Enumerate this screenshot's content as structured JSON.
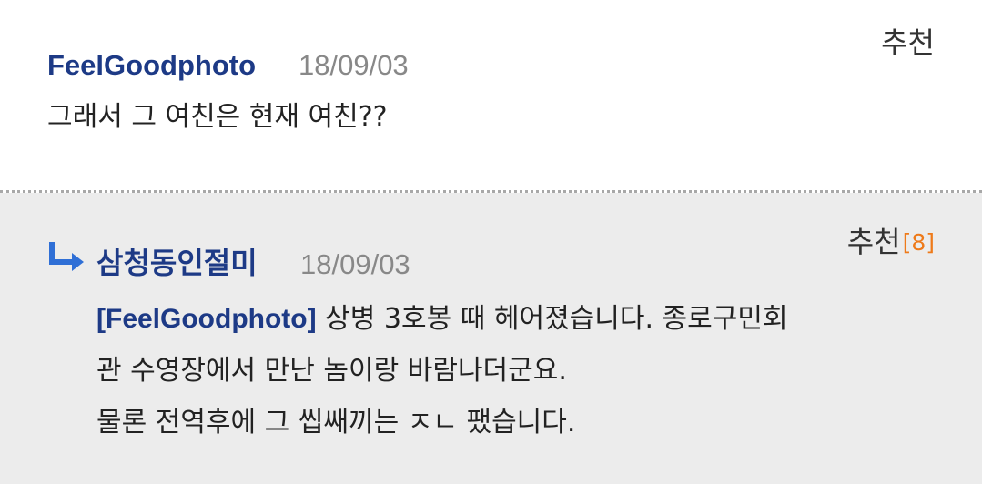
{
  "comments": [
    {
      "author": "FeelGoodphoto",
      "date": "18/09/03",
      "recommend_label": "추천",
      "text": "그래서 그 여친은 현재 여친??"
    },
    {
      "author": "삼청동인절미",
      "date": "18/09/03",
      "recommend_label": "추천",
      "recommend_count": "[8]",
      "mention": "[FeelGoodphoto]",
      "lines": [
        "상병 3호봉 때 헤어졌습니다. 종로구민회",
        "관 수영장에서 만난 놈이랑 바람나더군요.",
        "물론 전역후에 그 씹쌔끼는 ㅈㄴ 팼습니다."
      ]
    }
  ],
  "colors": {
    "author": "#1d3a86",
    "date": "#888888",
    "count": "#ee7a1a",
    "reply_bg": "#ececec"
  },
  "icons": {
    "reply": "reply-arrow-icon"
  }
}
